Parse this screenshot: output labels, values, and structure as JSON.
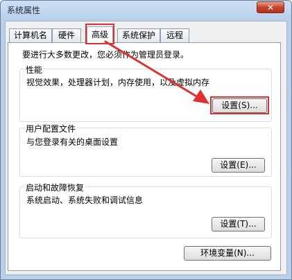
{
  "window": {
    "title": "系统属性",
    "close_symbol": "✕"
  },
  "tabs": [
    {
      "label": "计算机名",
      "active": false
    },
    {
      "label": "硬件",
      "active": false
    },
    {
      "label": "高级",
      "active": true
    },
    {
      "label": "系统保护",
      "active": false
    },
    {
      "label": "远程",
      "active": false
    }
  ],
  "advanced": {
    "admin_notice": "要进行大多数更改，您必须作为管理员登录。",
    "performance": {
      "title": "性能",
      "description": "视觉效果，处理器计划，内存使用，以及虚拟内存",
      "button": "设置(S)..."
    },
    "user_profiles": {
      "title": "用户配置文件",
      "description": "与您登录有关的桌面设置",
      "button": "设置(E)..."
    },
    "startup_recovery": {
      "title": "启动和故障恢复",
      "description": "系统启动、系统失败和调试信息",
      "button": "设置(T)..."
    },
    "env_vars_button": "环境变量(N)..."
  },
  "annotations": {
    "highlight_color": "#e03030",
    "arrow": "red-arrow-from-advanced-tab-to-performance-settings"
  }
}
